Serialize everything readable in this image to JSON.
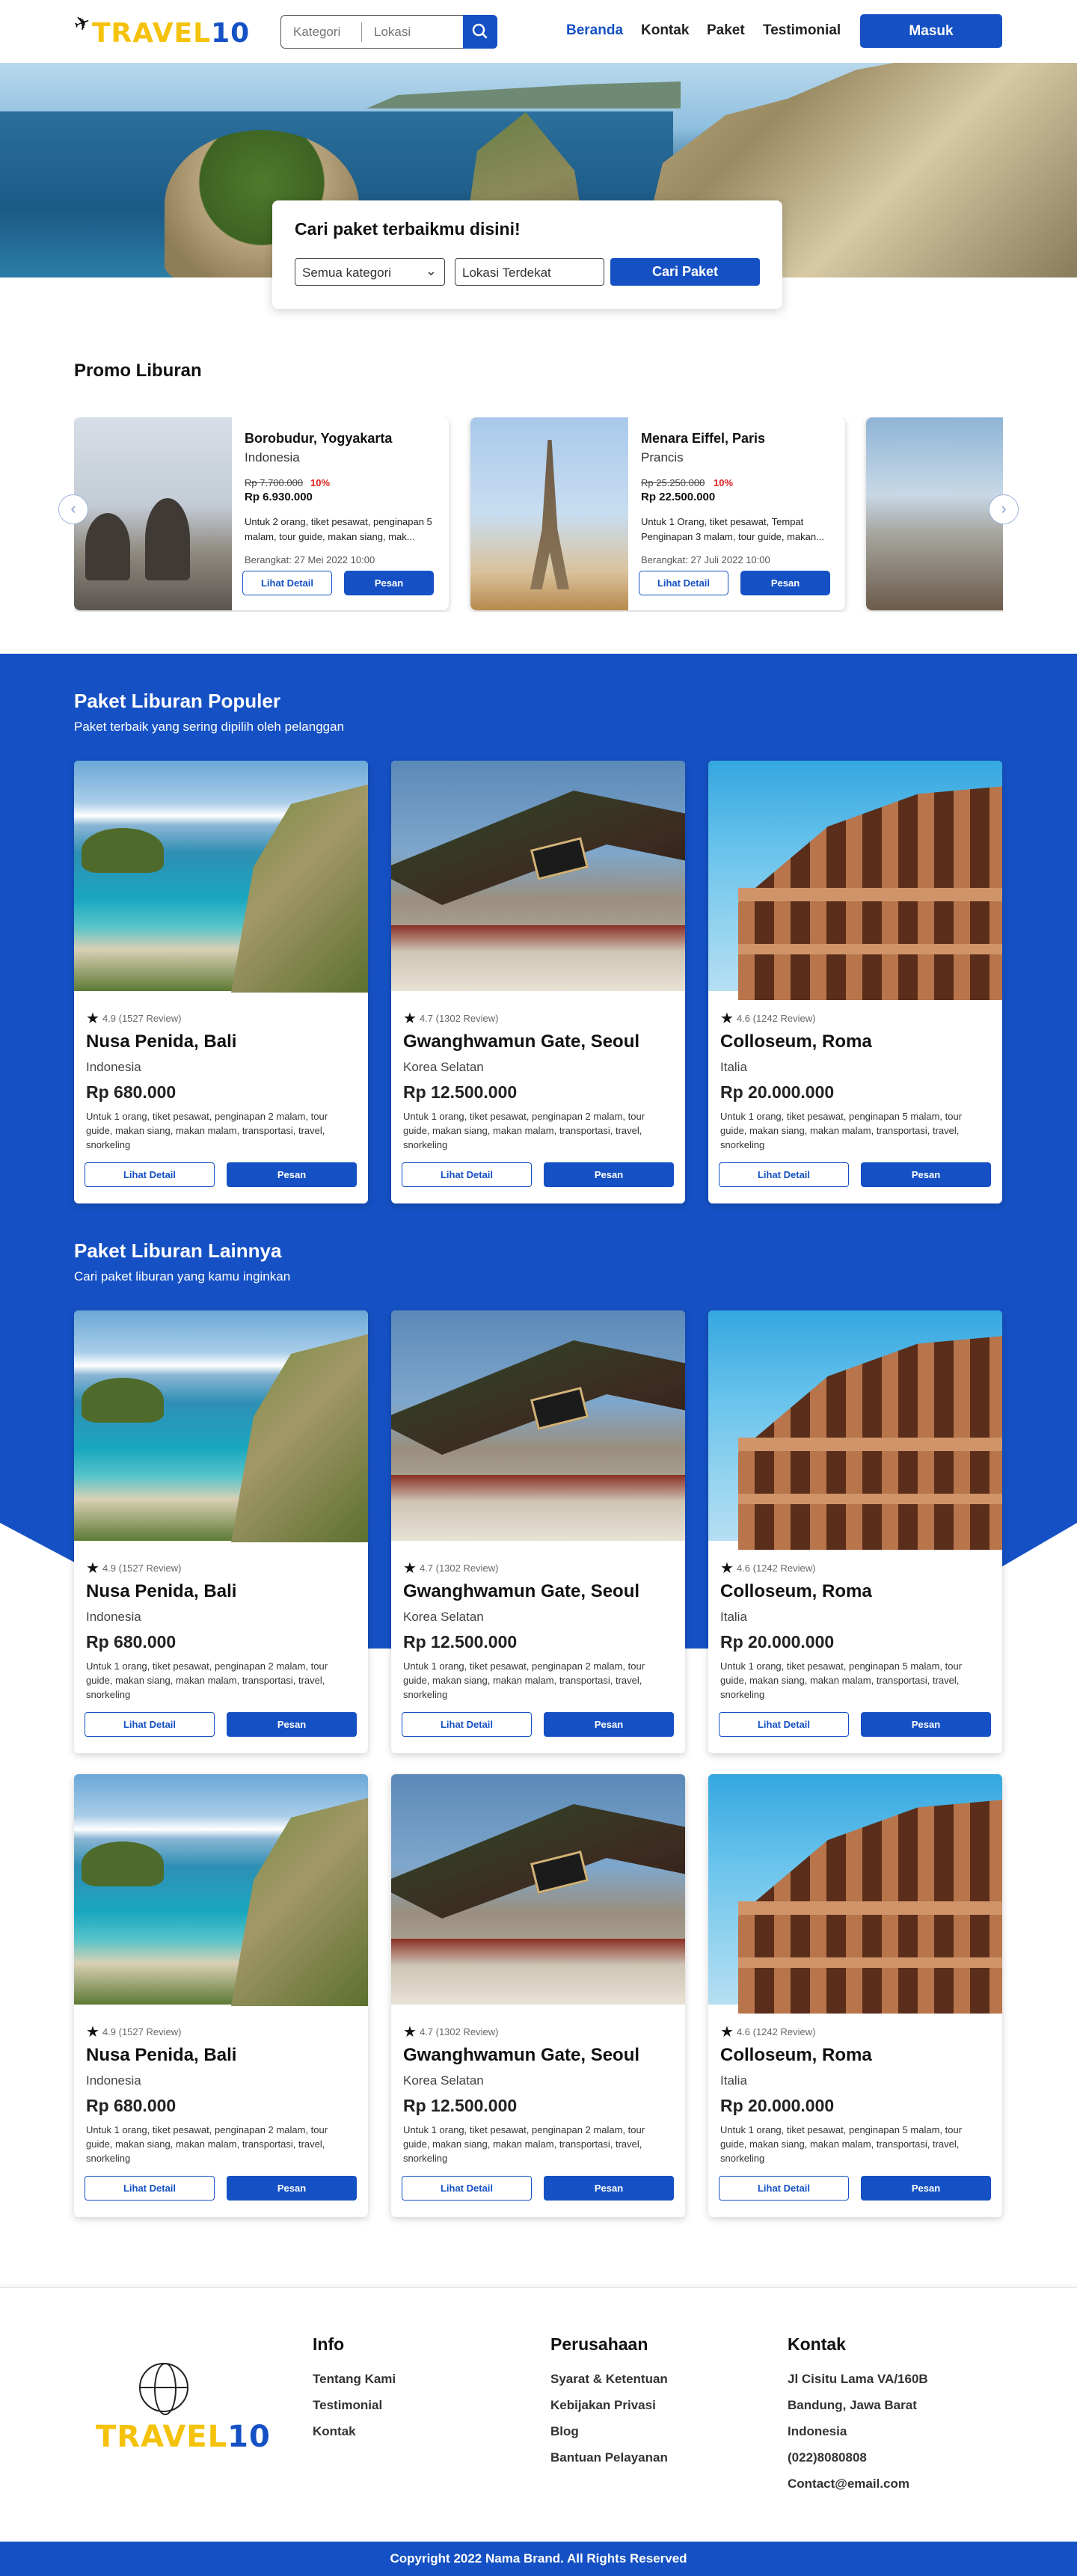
{
  "header": {
    "logo_part1": "TRAVEL",
    "logo_part2": "10",
    "search": {
      "category_placeholder": "Kategori",
      "location_placeholder": "Lokasi"
    },
    "nav": [
      "Beranda",
      "Kontak",
      "Paket",
      "Testimonial"
    ],
    "login_label": "Masuk"
  },
  "hero": {
    "search_title": "Cari paket terbaikmu disini!",
    "category_select": "Semua kategori",
    "location_placeholder": "Lokasi Terdekat",
    "search_button": "Cari Paket"
  },
  "promo": {
    "title": "Promo Liburan",
    "items": [
      {
        "name": "Borobudur, Yogyakarta",
        "country": "Indonesia",
        "old_price": "Rp 7.700.000",
        "discount": "10%",
        "price": "Rp 6.930.000",
        "desc": "Untuk 2 orang, tiket pesawat, penginapan 5 malam, tour guide, makan siang, mak...",
        "date": "Berangkat: 27 Mei 2022 10:00",
        "detail_label": "Lihat Detail",
        "order_label": "Pesan"
      },
      {
        "name": "Menara Eiffel, Paris",
        "country": "Prancis",
        "old_price": "Rp 25.250.000",
        "discount": "10%",
        "price": "Rp 22.500.000",
        "desc": "Untuk 1 Orang, tiket pesawat, Tempat Penginapan 3 malam, tour guide, makan...",
        "date": "Berangkat: 27 Juli 2022 10:00",
        "detail_label": "Lihat Detail",
        "order_label": "Pesan"
      }
    ]
  },
  "popular": {
    "title": "Paket Liburan Populer",
    "subtitle": "Paket terbaik yang sering dipilih oleh pelanggan"
  },
  "others": {
    "title": "Paket Liburan Lainnya",
    "subtitle": "Cari paket liburan yang kamu inginkan"
  },
  "packages": [
    {
      "rating": "4.9 (1527 Review)",
      "name": "Nusa Penida, Bali",
      "country": "Indonesia",
      "price": "Rp 680.000",
      "desc": "Untuk 1 orang, tiket pesawat, penginapan 2 malam, tour guide, makan siang, makan malam, transportasi, travel, snorkeling",
      "detail_label": "Lihat Detail",
      "order_label": "Pesan"
    },
    {
      "rating": "4.7 (1302 Review)",
      "name": "Gwanghwamun Gate, Seoul",
      "country": "Korea Selatan",
      "price": "Rp 12.500.000",
      "desc": "Untuk 1 orang, tiket pesawat, penginapan 2 malam, tour guide, makan siang, makan malam, transportasi, travel, snorkeling",
      "detail_label": "Lihat Detail",
      "order_label": "Pesan"
    },
    {
      "rating": "4.6 (1242 Review)",
      "name": "Colloseum, Roma",
      "country": "Italia",
      "price": "Rp 20.000.000",
      "desc": "Untuk 1 orang, tiket pesawat, penginapan 5 malam, tour guide, makan siang, makan malam, transportasi, travel, snorkeling",
      "detail_label": "Lihat Detail",
      "order_label": "Pesan"
    }
  ],
  "footer": {
    "logo_part1": "TRAVEL",
    "logo_part2": "10",
    "info": {
      "title": "Info",
      "links": [
        "Tentang Kami",
        "Testimonial",
        "Kontak"
      ]
    },
    "company": {
      "title": "Perusahaan",
      "links": [
        "Syarat & Ketentuan",
        "Kebijakan Privasi",
        "Blog",
        "Bantuan Pelayanan"
      ]
    },
    "contact": {
      "title": "Kontak",
      "lines": [
        "Jl Cisitu Lama VA/160B",
        "Bandung, Jawa Barat",
        "Indonesia",
        "(022)8080808",
        "Contact@email.com"
      ]
    },
    "copyright": "Copyright 2022 Nama Brand. All Rights Reserved"
  },
  "colors": {
    "primary": "#1551c4",
    "logo_yellow": "#f5c20b",
    "discount_red": "#e02020"
  },
  "icons": [
    "plane-icon",
    "search-icon",
    "chevron-down-icon",
    "arrow-left-icon",
    "arrow-right-icon",
    "star-icon",
    "globe-icon"
  ]
}
